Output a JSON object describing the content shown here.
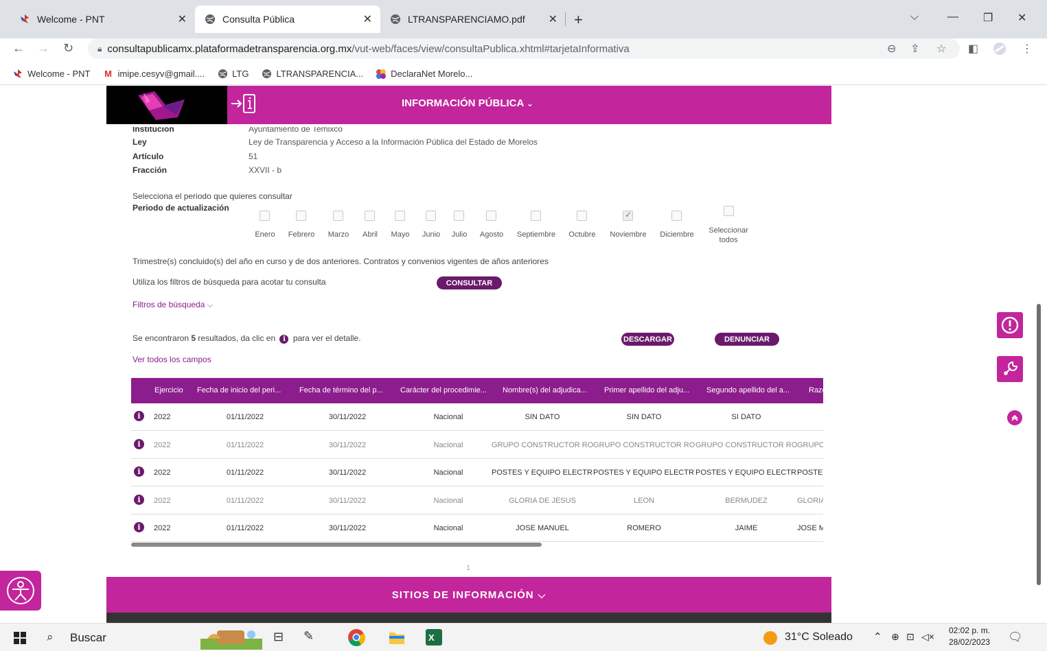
{
  "browser": {
    "tabs": [
      {
        "title": "Welcome - PNT",
        "active": false
      },
      {
        "title": "Consulta Pública",
        "active": true
      },
      {
        "title": "LTRANSPARENCIAMO.pdf",
        "active": false
      }
    ],
    "url_host": "consultapublicamx.plataformadetransparencia.org.mx",
    "url_path": "/vut-web/faces/view/consultaPublica.xhtml#tarjetaInformativa",
    "bookmarks": [
      {
        "label": "Welcome - PNT"
      },
      {
        "label": "imipe.cesyv@gmail...."
      },
      {
        "label": "LTG"
      },
      {
        "label": "LTRANSPARENCIA..."
      },
      {
        "label": "DeclaraNet Morelo..."
      }
    ]
  },
  "header": {
    "info_publica": "INFORMACIÓN PÚBLICA",
    "sitios": "SITIOS DE INFORMACIÓN"
  },
  "meta": {
    "institucion_label": "Institución",
    "institucion_value": "Ayuntamiento de Temixco",
    "ley_label": "Ley",
    "ley_value": "Ley de Transparencia y Acceso a la Información Pública del Estado de Morelos",
    "articulo_label": "Artículo",
    "articulo_value": "51",
    "fraccion_label": "Fracción",
    "fraccion_value": "XXVII - b"
  },
  "periodo": {
    "instruction": "Selecciona el periodo que quieres consultar",
    "label": "Periodo de actualización",
    "months": [
      "Enero",
      "Febrero",
      "Marzo",
      "Abril",
      "Mayo",
      "Junio",
      "Julio",
      "Agosto",
      "Septiembre",
      "Octubre",
      "Noviembre",
      "Diciembre"
    ],
    "checked_month": "Noviembre",
    "select_all_1": "Seleccionar",
    "select_all_2": "todos",
    "note": "Trimestre(s) concluido(s) del año en curso y de dos anteriores. Contratos y convenios vigentes de años anteriores"
  },
  "search": {
    "filters_hint": "Utiliza los filtros de búsqueda para acotar tu consulta",
    "consultar": "CONSULTAR",
    "filtros_link": "Filtros de búsqueda",
    "results_pre": "Se encontraron ",
    "results_count": "5",
    "results_post": " resultados, da clic en",
    "results_end": "para ver el detalle.",
    "descargar": "DESCARGAR",
    "denunciar": "DENUNCIAR",
    "ver_todos": "Ver todos los campos"
  },
  "table": {
    "columns": [
      "Ejercicio",
      "Fecha de inicio del peri...",
      "Fecha de término del p...",
      "Carácter del procedimie...",
      "Nombre(s) del adjudica...",
      "Primer apellido del adju...",
      "Segundo apellido del a...",
      "Razo"
    ],
    "rows": [
      [
        "2022",
        "01/11/2022",
        "30/11/2022",
        "Nacional",
        "SIN DATO",
        "SIN DATO",
        "SI DATO",
        ""
      ],
      [
        "2022",
        "01/11/2022",
        "30/11/2022",
        "Nacional",
        "GRUPO CONSTRUCTOR ROL...",
        "GRUPO CONSTRUCTOR ROL...",
        "GRUPO CONSTRUCTOR ROL...",
        "GRUPC"
      ],
      [
        "2022",
        "01/11/2022",
        "30/11/2022",
        "Nacional",
        "POSTES Y EQUIPO ELECTRIC...",
        "POSTES Y EQUIPO ELECTRIC...",
        "POSTES Y EQUIPO ELECTRIC...",
        "POSTES"
      ],
      [
        "2022",
        "01/11/2022",
        "30/11/2022",
        "Nacional",
        "GLORIA DE JESUS",
        "LEON",
        "BERMUDEZ",
        "GLORIA"
      ],
      [
        "2022",
        "01/11/2022",
        "30/11/2022",
        "Nacional",
        "JOSE MANUEL",
        "ROMERO",
        "JAIME",
        "JOSE M"
      ]
    ],
    "page": "1"
  },
  "taskbar": {
    "search": "Buscar",
    "weather": "31°C  Soleado",
    "time": "02:02 p. m.",
    "date": "28/02/2023"
  },
  "colors": {
    "brand_magenta": "#c2259c",
    "brand_purple": "#6b1a6b",
    "table_header": "#8c1d8c"
  }
}
